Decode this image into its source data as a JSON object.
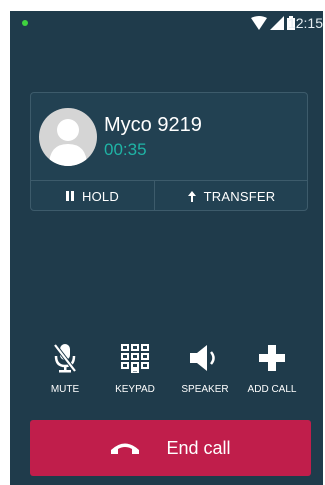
{
  "status_bar": {
    "time": "12:15",
    "icons": [
      "notification-dot",
      "wifi-icon",
      "signal-icon",
      "battery-icon"
    ]
  },
  "call": {
    "caller_name": "Myco 9219",
    "duration": "00:35",
    "hold_label": "HOLD",
    "transfer_label": "TRANSFER"
  },
  "actions": [
    {
      "label": "MUTE",
      "icon": "mic-off-icon"
    },
    {
      "label": "KEYPAD",
      "icon": "keypad-icon"
    },
    {
      "label": "SPEAKER",
      "icon": "speaker-icon"
    },
    {
      "label": "ADD CALL",
      "icon": "plus-icon"
    }
  ],
  "end_call": {
    "label": "End call",
    "icon": "phone-hangup-icon"
  },
  "colors": {
    "background": "#1f3b4b",
    "card": "#224152",
    "accent_timer": "#1fb3a5",
    "end_call": "#c01e4b"
  }
}
